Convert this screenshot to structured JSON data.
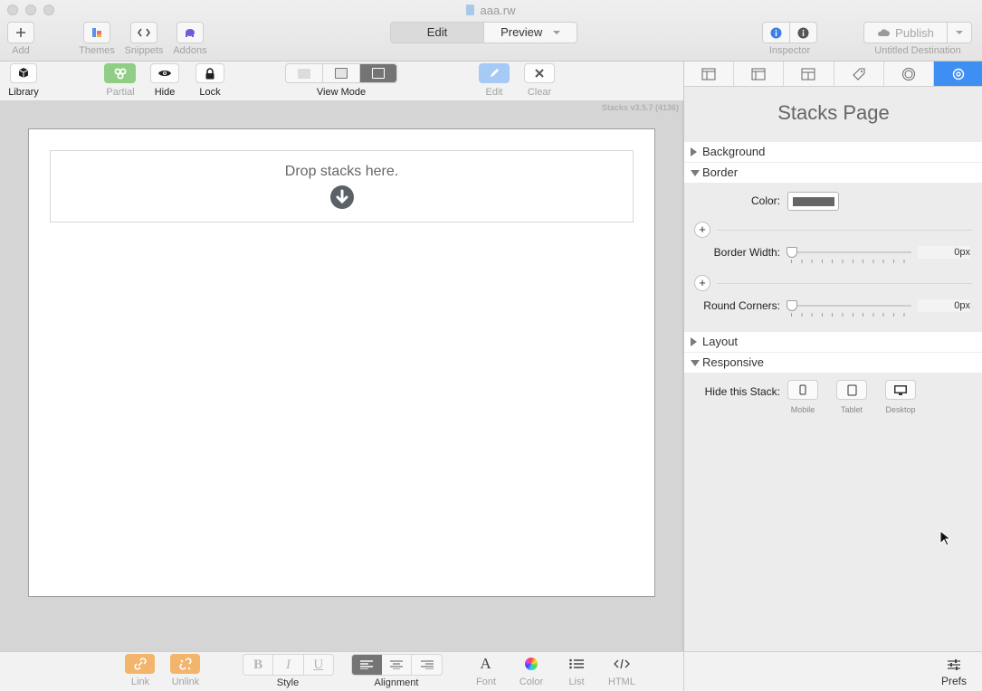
{
  "window": {
    "title": "aaa.rw"
  },
  "toolbar": {
    "add": "Add",
    "themes": "Themes",
    "snippets": "Snippets",
    "addons": "Addons",
    "mode_edit": "Edit",
    "mode_preview": "Preview",
    "inspector": "Inspector",
    "publish": "Publish",
    "destination": "Untitled Destination"
  },
  "stacks_toolbar": {
    "library": "Library",
    "partial": "Partial",
    "hide": "Hide",
    "lock": "Lock",
    "view_mode": "View Mode",
    "edit": "Edit",
    "clear": "Clear"
  },
  "canvas": {
    "version": "Stacks v3.5.7 (4136)",
    "drop_text": "Drop stacks here."
  },
  "bottom_toolbar": {
    "link": "Link",
    "unlink": "Unlink",
    "style": "Style",
    "bold": "B",
    "italic": "I",
    "underline": "U",
    "alignment": "Alignment",
    "font": "Font",
    "font_glyph": "A",
    "color": "Color",
    "list": "List",
    "html": "HTML",
    "prefs": "Prefs"
  },
  "panel": {
    "title": "Stacks Page",
    "sections": {
      "background": "Background",
      "border": "Border",
      "layout": "Layout",
      "responsive": "Responsive"
    },
    "border": {
      "color_label": "Color:",
      "color_value": "#666666",
      "width_label": "Border Width:",
      "width_value": "0px",
      "corners_label": "Round Corners:",
      "corners_value": "0px"
    },
    "responsive": {
      "hide_label": "Hide this Stack:",
      "mobile": "Mobile",
      "tablet": "Tablet",
      "desktop": "Desktop"
    }
  },
  "colors": {
    "accent": "#3d8ff4",
    "partial": "#8fce84",
    "link": "#f3b46b"
  }
}
